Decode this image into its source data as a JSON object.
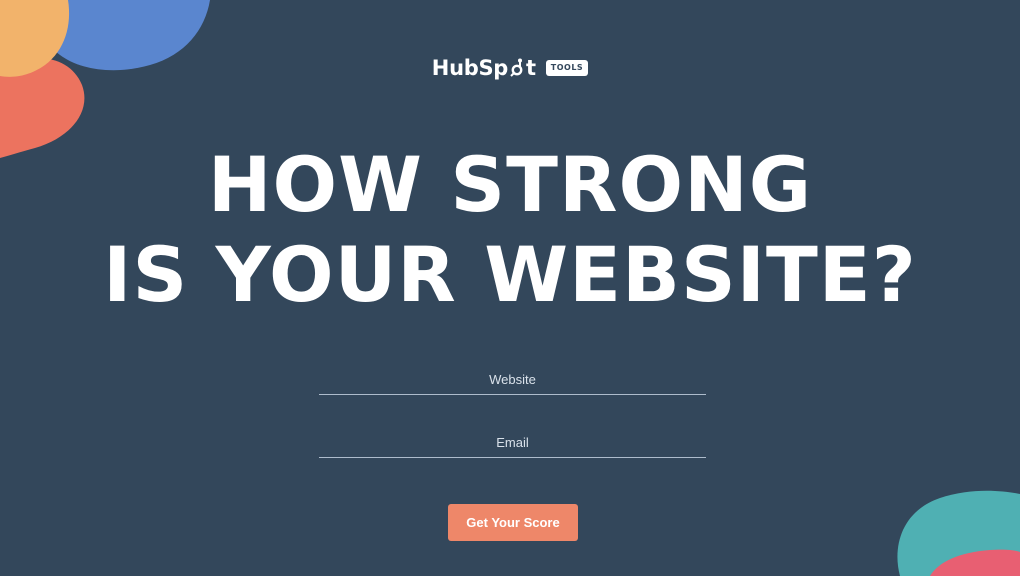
{
  "logo": {
    "wordmark_left": "HubSp",
    "wordmark_right": "t",
    "badge": "TOOLS"
  },
  "headline": {
    "line1": "HOW STRONG",
    "line2": "IS YOUR WEBSITE?"
  },
  "form": {
    "website_placeholder": "Website",
    "email_placeholder": "Email",
    "submit_label": "Get Your Score"
  },
  "colors": {
    "background": "#33475b",
    "button": "#ee8769",
    "blob_orange": "#f2b36b",
    "blob_coral": "#ec735f",
    "blob_blue": "#5a86cf",
    "blob_teal": "#4fb0b3",
    "blob_pink": "#e85f72"
  }
}
